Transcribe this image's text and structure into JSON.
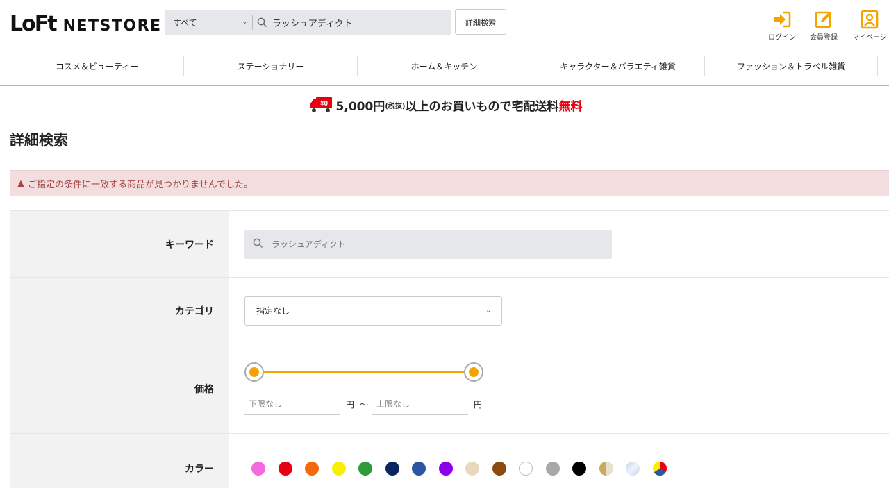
{
  "logo": {
    "mark": "LoFt",
    "text": "NETSTORE"
  },
  "header_search": {
    "category": "すべて",
    "query": "ラッシュアディクト",
    "advanced_label": "詳細検索"
  },
  "user_nav": [
    {
      "label": "ログイン",
      "icon": "login-icon"
    },
    {
      "label": "会員登録",
      "icon": "register-icon"
    },
    {
      "label": "マイページ",
      "icon": "mypage-icon"
    }
  ],
  "categories": [
    "コスメ＆ビューティー",
    "ステーショナリー",
    "ホーム＆キッチン",
    "キャラクター＆バラエティ雑貨",
    "ファッション＆トラベル雑貨"
  ],
  "promo": {
    "badge": "¥0",
    "amount": "5,000円",
    "tax": "(税抜)",
    "text": "以上のお買いもので宅配送料",
    "highlight": "無料"
  },
  "page_title": "詳細検索",
  "alert": "ご指定の条件に一致する商品が見つかりませんでした。",
  "form": {
    "keyword": {
      "label": "キーワード",
      "value": "ラッシュアディクト"
    },
    "category": {
      "label": "カテゴリ",
      "value": "指定なし"
    },
    "price": {
      "label": "価格",
      "min_placeholder": "下限なし",
      "max_placeholder": "上限なし",
      "unit": "円",
      "separator": "〜",
      "range_low": 0.0,
      "range_high": 1.0
    },
    "color": {
      "label": "カラー"
    }
  },
  "colors": {
    "accent": "#f5a300",
    "alert_text": "#a94442",
    "swatches": [
      "#f36ae0",
      "#e60012",
      "#f26a0f",
      "#f8f000",
      "#2e9a3b",
      "#0b2560",
      "#2c56a2",
      "#8c00e6",
      "#e8d9bc",
      "#8a4a12",
      "#ffffff",
      "#a8a8a8",
      "#000000",
      "gold",
      "silver",
      "multi"
    ]
  }
}
